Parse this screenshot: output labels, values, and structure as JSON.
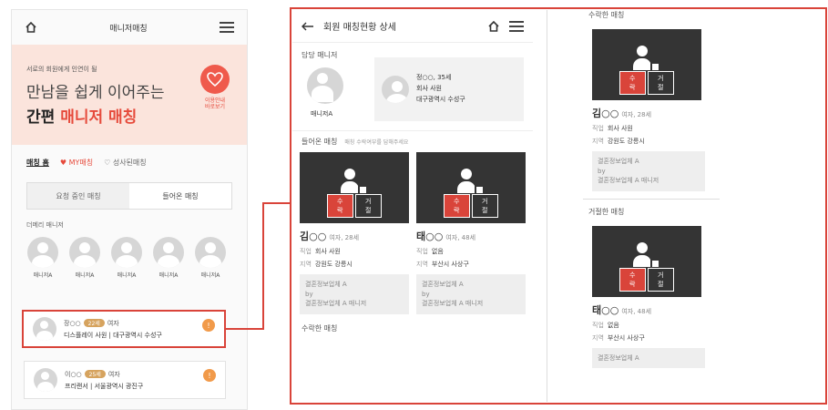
{
  "left": {
    "header_title": "매니저매칭",
    "banner": {
      "sub": "서로의 회원에게 인연이 될",
      "line1": "만남을 쉽게 이어주는",
      "line2_prefix": "간편",
      "line2_highlight": "매니저 매칭",
      "badge_text1": "이용안내",
      "badge_text2": "바로보기"
    },
    "tabs": [
      "매칭 홈",
      "MY매칭",
      "성사된매칭"
    ],
    "segment": {
      "left": "요청 중인 매칭",
      "right": "들어온 매칭"
    },
    "section_label": "더메리 매니저",
    "avatars": [
      "매니저A",
      "매니저A",
      "매니저A",
      "매니저A",
      "매니저A"
    ],
    "cards": [
      {
        "name": "장○○",
        "badge": "22세",
        "suffix": "여자",
        "line2": "디스플레이 사원 | 대구광역시 수성구",
        "alert": "!"
      },
      {
        "name": "이○○",
        "badge": "25세",
        "suffix": "여자",
        "line2": "프리랜서 | 서울광역시 광진구",
        "alert": "!"
      }
    ]
  },
  "middle": {
    "title": "회원 매칭현황 상세",
    "manager_label": "담당 매니저",
    "manager_name": "매니저A",
    "member": {
      "name": "정○○, 35세",
      "job": "회사 사원",
      "loc": "대구광역시 수성구"
    },
    "incoming_label": "들어온 매칭",
    "incoming_hint": "매칭 수락여부를 답해주세요",
    "accept": "수락",
    "reject": "거절",
    "cards": [
      {
        "name": "김○○",
        "meta": "여자, 28세",
        "job_label": "직업",
        "job": "회사 사원",
        "loc_label": "지역",
        "loc": "강원도 강릉시",
        "agency": "결혼정보업체 A",
        "by": "by",
        "by_name": "결혼정보업체 A 매니저"
      },
      {
        "name": "태○○",
        "meta": "여자, 48세",
        "job_label": "직업",
        "job": "없음",
        "loc_label": "지역",
        "loc": "부산시 사상구",
        "agency": "결혼정보업체 A",
        "by": "by",
        "by_name": "결혼정보업체 A 매니저"
      }
    ],
    "accepted_label": "수락한 매칭"
  },
  "right": {
    "accepted_label": "수락한 매칭",
    "card1": {
      "name": "김○○",
      "meta": "여자, 28세",
      "job_label": "직업",
      "job": "회사 사원",
      "loc_label": "지역",
      "loc": "강원도 강릉시",
      "agency": "결혼정보업체 A",
      "by": "by",
      "by_name": "결혼정보업체 A 매니저"
    },
    "rejected_label": "거절한 매칭",
    "card2": {
      "name": "태○○",
      "meta": "여자, 48세",
      "job_label": "직업",
      "job": "없음",
      "loc_label": "지역",
      "loc": "부산시 사상구",
      "agency": "결혼정보업체 A"
    }
  }
}
